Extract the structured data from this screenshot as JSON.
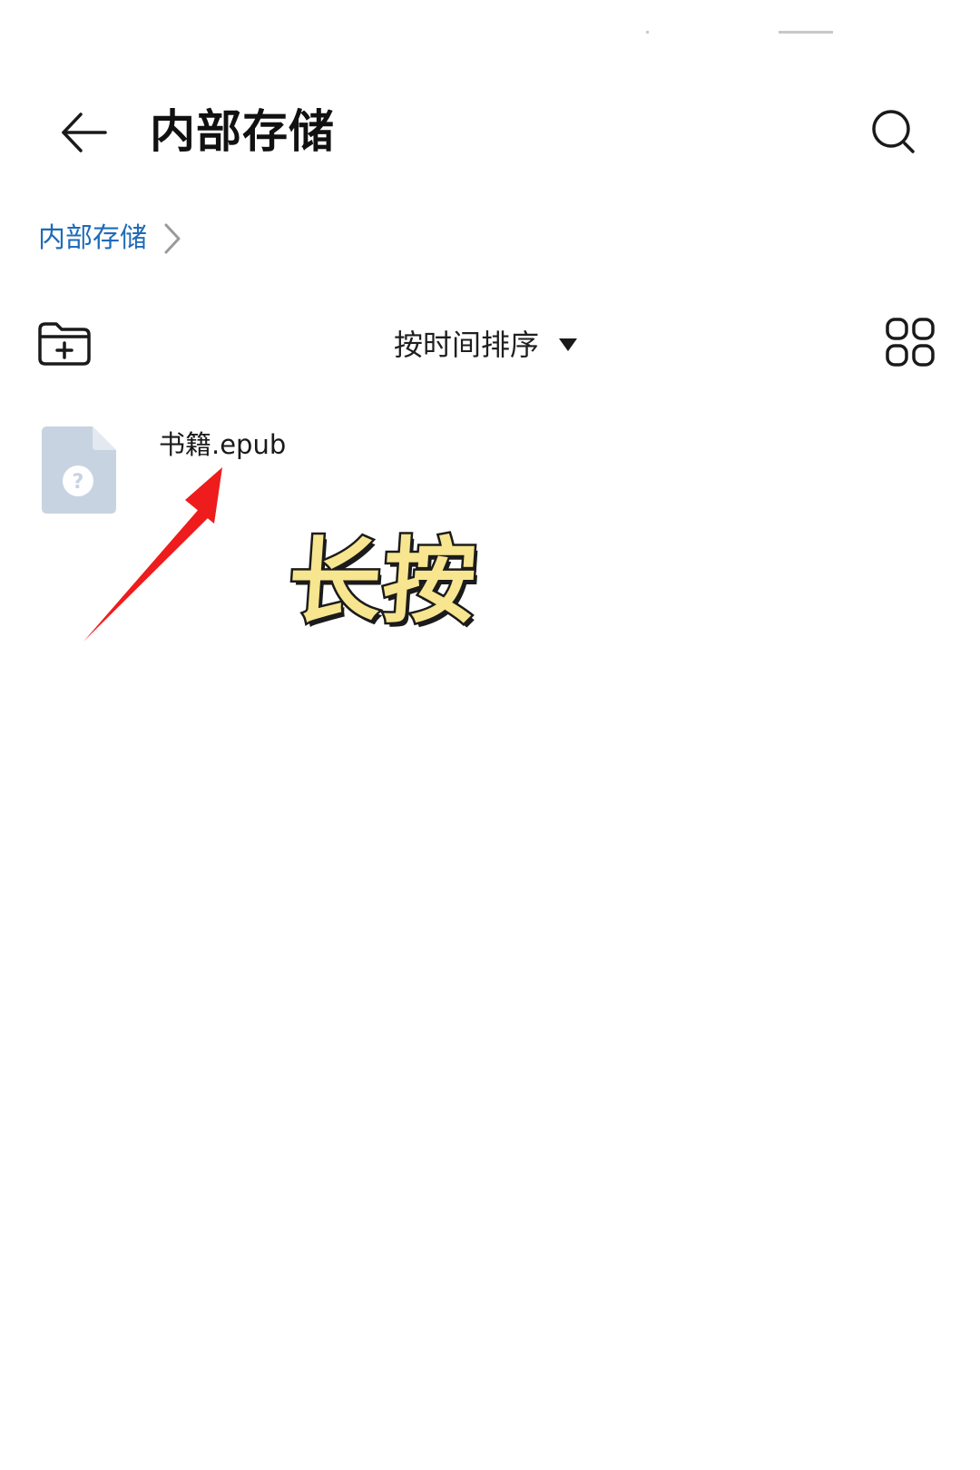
{
  "header": {
    "title": "内部存储",
    "back_icon": "arrow-left-icon",
    "search_icon": "search-icon"
  },
  "breadcrumb": {
    "items": [
      {
        "label": "内部存储"
      }
    ],
    "chevron_icon": "chevron-right-icon"
  },
  "toolbar": {
    "new_folder_icon": "new-folder-icon",
    "sort_label": "按时间排序",
    "sort_caret_icon": "caret-down-icon",
    "view_toggle_icon": "grid-view-icon"
  },
  "files": [
    {
      "name": "书籍.epub",
      "icon": "unknown-file-icon"
    }
  ],
  "annotation": {
    "text": "长按",
    "arrow_icon": "red-arrow-icon"
  },
  "colors": {
    "accent": "#1f6bb8",
    "annotation_fill": "#f7e58f",
    "annotation_arrow": "#ee1c1c",
    "file_icon": "#c7d3e0"
  }
}
